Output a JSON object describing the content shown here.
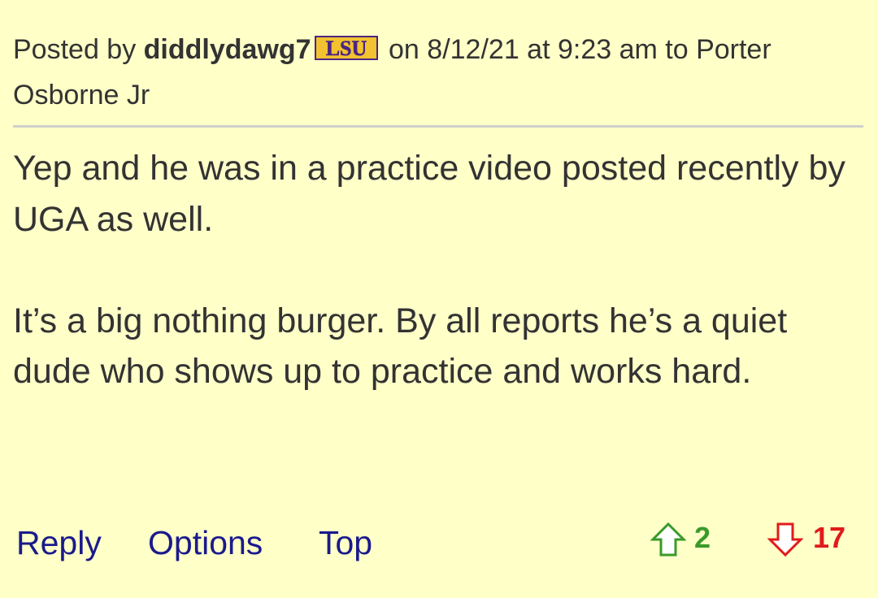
{
  "post": {
    "header": {
      "prefix": "Posted by ",
      "author": "diddlydawg7",
      "team_badge_text": "LSU",
      "suffix": " on 8/12/21 at 9:23 am to Porter Osborne Jr"
    },
    "body": {
      "paragraphs": [
        "Yep and he was in a practice video posted recently by UGA as well.",
        "It’s a big nothing burger. By all reports he’s a quiet dude who shows up to practice and works hard."
      ]
    },
    "actions": {
      "reply_label": "Reply",
      "options_label": "Options",
      "top_label": "Top"
    },
    "votes": {
      "upvotes": "2",
      "downvotes": "17"
    }
  },
  "colors": {
    "background": "#ffffc8",
    "text": "#333333",
    "link": "#1a1a8c",
    "upvote": "#3a9a2a",
    "downvote": "#e01b1b",
    "lsu_purple": "#4b2680",
    "lsu_gold": "#f2c230"
  },
  "icons": {
    "team_badge": "lsu-logo-icon",
    "upvote": "up-arrow-icon",
    "downvote": "down-arrow-icon"
  }
}
